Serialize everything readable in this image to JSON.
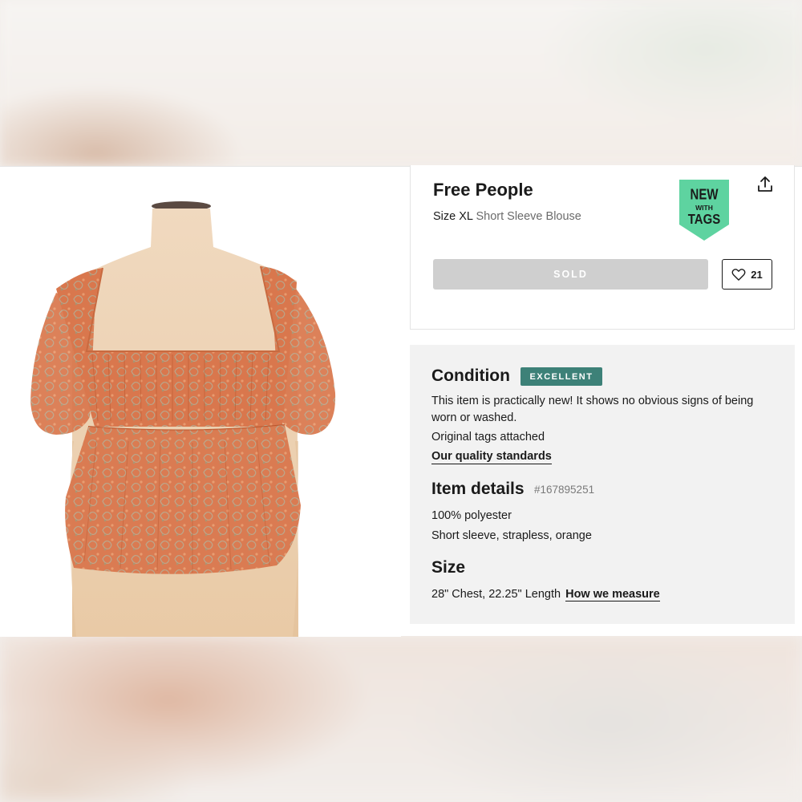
{
  "product": {
    "brand": "Free People",
    "size_label": "Size XL",
    "category": "Short Sleeve Blouse",
    "badge": {
      "line1": "NEW",
      "line2": "WITH",
      "line3": "TAGS",
      "color": "#5ed3a0"
    },
    "sold_label": "SOLD",
    "likes_count": "21",
    "image_alt": "Orange paisley short sleeve blouse on mannequin"
  },
  "condition": {
    "title": "Condition",
    "badge": "EXCELLENT",
    "badge_color": "#3d8178",
    "description": "This item is practically new! It shows no obvious signs of being worn or washed.",
    "tags_note": "Original tags attached",
    "quality_link": "Our quality standards"
  },
  "item_details": {
    "title": "Item details",
    "item_number": "#167895251",
    "material": "100% polyester",
    "features": "Short sleeve, strapless, orange"
  },
  "size": {
    "title": "Size",
    "measurements": "28\" Chest, 22.25\" Length",
    "measure_link": "How we measure"
  },
  "icons": {
    "share": "share-icon",
    "heart": "heart-icon"
  }
}
